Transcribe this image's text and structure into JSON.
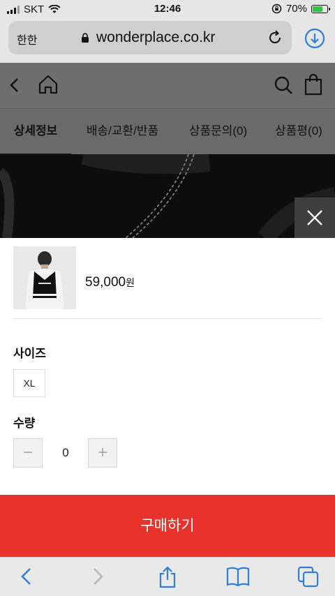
{
  "status_bar": {
    "carrier": "SKT",
    "time": "12:46",
    "battery": "70%",
    "battery_level": 0.7
  },
  "browser": {
    "aa_label": "한한",
    "url": "wonderplace.co.kr"
  },
  "tabs": [
    {
      "label": "상세정보",
      "active": true
    },
    {
      "label": "배송/교환/반품",
      "active": false
    },
    {
      "label": "상품문의(0)",
      "active": false
    },
    {
      "label": "상품평(0)",
      "active": false
    }
  ],
  "product": {
    "price": "59,000",
    "currency": "원"
  },
  "options": {
    "size_label": "사이즈",
    "size_value": "XL",
    "quantity_label": "수량",
    "quantity": "0",
    "minus": "−",
    "plus": "+"
  },
  "buy_button": "구매하기",
  "colors": {
    "accent": "#e7332b",
    "safari_blue": "#2f7fd8"
  },
  "icons": [
    "signal-icon",
    "wifi-icon",
    "rotation-lock-icon",
    "battery-icon",
    "lock-icon",
    "reload-icon",
    "download-icon",
    "back-icon",
    "home-icon",
    "search-icon",
    "bag-icon",
    "close-icon",
    "share-icon",
    "bookmarks-icon",
    "tabs-icon",
    "forward-icon"
  ]
}
